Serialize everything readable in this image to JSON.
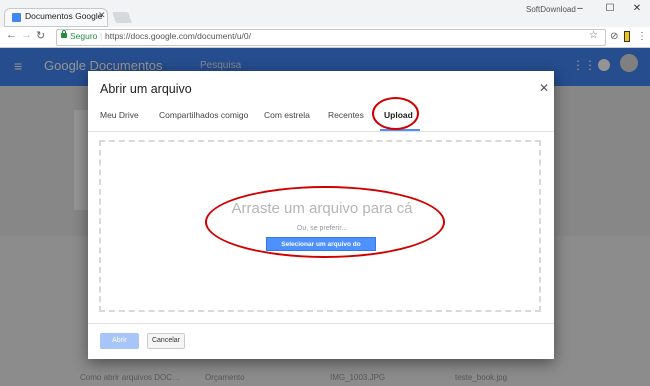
{
  "browser": {
    "tab_title": "Documentos Google",
    "brand": "SoftDownload",
    "secure_label": "Seguro",
    "url": "https://docs.google.com/document/u/0/"
  },
  "app": {
    "name": "Google Documentos",
    "search_placeholder": "Pesquisa",
    "files": [
      "Como abrir arquivos DOC…",
      "Orçamento",
      "IMG_1003.JPG",
      "teste_book.jpg"
    ]
  },
  "dialog": {
    "title": "Abrir um arquivo",
    "tabs": [
      "Meu Drive",
      "Compartilhados comigo",
      "Com estrela",
      "Recentes",
      "Upload"
    ],
    "active_tab": "Upload",
    "drop_title": "Arraste um arquivo para cá",
    "or_label": "Ou, se preferir...",
    "select_button": "Selecionar um arquivo do computador",
    "open_button": "Abrir",
    "cancel_button": "Cancelar"
  },
  "colors": {
    "accent": "#4285f4",
    "button_blue": "#4d90fe",
    "annotation_red": "#d10000"
  }
}
